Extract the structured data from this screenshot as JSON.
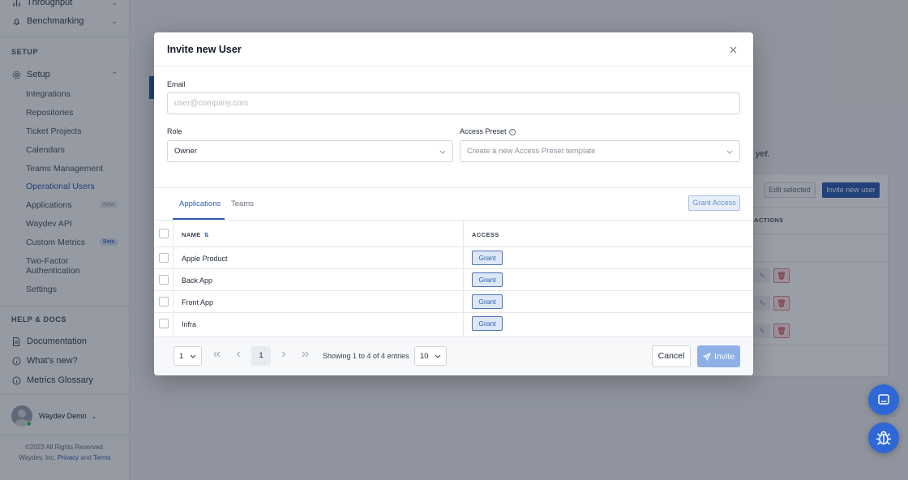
{
  "sidebar": {
    "top_items": [
      {
        "label": "Throughput",
        "icon": "chart-icon"
      },
      {
        "label": "Benchmarking",
        "icon": "bell-icon"
      }
    ],
    "setup_section_title": "SETUP",
    "setup_item": {
      "label": "Setup",
      "icon": "gear-icon"
    },
    "setup_subitems": [
      {
        "label": "Integrations"
      },
      {
        "label": "Repositories"
      },
      {
        "label": "Ticket Projects"
      },
      {
        "label": "Calendars"
      },
      {
        "label": "Teams Management"
      },
      {
        "label": "Operational Users",
        "active": true
      },
      {
        "label": "Applications",
        "tag": "New"
      },
      {
        "label": "Waydev API"
      },
      {
        "label": "Custom Metrics",
        "tag": "Beta"
      },
      {
        "label": "Two-Factor Authentication"
      },
      {
        "label": "Settings"
      }
    ],
    "help_section_title": "HELP & DOCS",
    "help_items": [
      {
        "label": "Documentation",
        "icon": "document-icon"
      },
      {
        "label": "What's new?",
        "icon": "info-icon"
      },
      {
        "label": "Metrics Glossary",
        "icon": "info-icon"
      }
    ],
    "user_name": "Waydev Demo",
    "footer_line1": "©2023 All Rights Reserved.",
    "footer_prefix": "Waydev, Inc.",
    "footer_privacy": "Privacy",
    "footer_and": "and",
    "footer_terms": "Terms"
  },
  "background": {
    "edit_selected": "Edit selected",
    "invite_new_user": "Invite new user",
    "actions_header": "ACTIONS",
    "italic_text": "yet."
  },
  "modal": {
    "title": "Invite new User",
    "email_label": "Email",
    "email_placeholder": "user@company.com",
    "role_label": "Role",
    "role_value": "Owner",
    "access_preset_label": "Access Preset",
    "access_preset_placeholder": "Create a new Access Preset template",
    "tabs": [
      {
        "label": "Applications",
        "active": true
      },
      {
        "label": "Teams",
        "active": false
      }
    ],
    "grant_access_label": "Grant Access",
    "table": {
      "headers": {
        "name": "NAME",
        "access": "ACCESS"
      },
      "rows": [
        {
          "name": "Apple Product",
          "action": "Grant"
        },
        {
          "name": "Back App",
          "action": "Grant"
        },
        {
          "name": "Front App",
          "action": "Grant"
        },
        {
          "name": "Infra",
          "action": "Grant"
        }
      ]
    },
    "pagination": {
      "page_select": "1",
      "current_page": "1",
      "info": "Showing 1 to 4 of 4 entries",
      "per_page": "10"
    },
    "cancel_label": "Cancel",
    "invite_label": "Invite"
  },
  "colors": {
    "accent": "#2d5fb3",
    "fab": "#2f68d6",
    "invite_disabled": "#8fb0e6"
  }
}
